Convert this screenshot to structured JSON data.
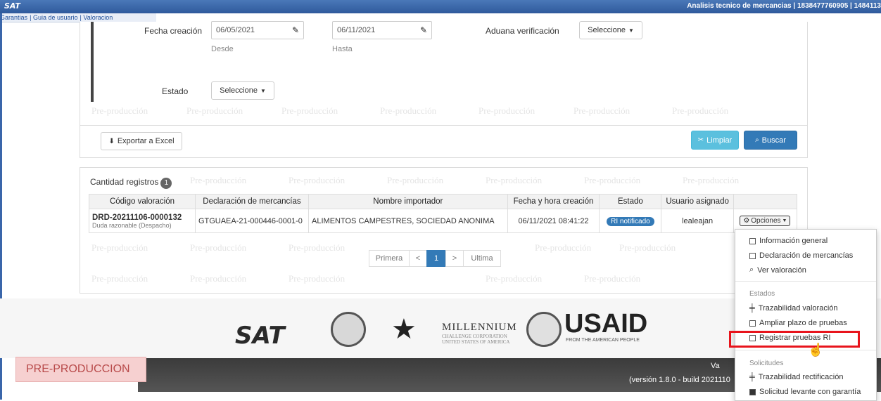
{
  "header": {
    "logo": "SAT",
    "title": "Analisis tecnico de mercancias | 1838477760905 | 1484113",
    "nav": [
      "Garantias",
      "Guia de usuario",
      "Valoracion"
    ]
  },
  "filters": {
    "fecha_label": "Fecha creación",
    "fecha_desde": "06/05/2021",
    "fecha_hasta": "06/11/2021",
    "desde_label": "Desde",
    "hasta_label": "Hasta",
    "aduana_label": "Aduana verificación",
    "aduana_value": "Seleccione",
    "estado_label": "Estado",
    "estado_value": "Seleccione"
  },
  "actions": {
    "export": "Exportar a Excel",
    "clear": "Limpiar",
    "search": "Buscar"
  },
  "results": {
    "count_label": "Cantidad registros",
    "count": "1",
    "columns": [
      "Código valoración",
      "Declaración de mercancías",
      "Nombre importador",
      "Fecha y hora creación",
      "Estado",
      "Usuario asignado",
      ""
    ],
    "row": {
      "codigo": "DRD-20211106-0000132",
      "codigo_sub": "Duda razonable (Despacho)",
      "declaracion": "GTGUAEA-21-000446-0001-0",
      "importador": "ALIMENTOS CAMPESTRES, SOCIEDAD ANONIMA",
      "fecha": "06/11/2021 08:41:22",
      "estado": "RI notificado",
      "usuario": "lealeajan",
      "opciones": "Opciones"
    },
    "pager": [
      "Primera",
      "<",
      "1",
      ">",
      "Ultima"
    ]
  },
  "watermark": "Pre-producción",
  "footer": {
    "logos": [
      "SAT",
      "MILLENNIUM",
      "CHALLENGE CORPORATION",
      "UNITED STATES OF AMERICA",
      "USAID",
      "FROM THE AMERICAN PEOPLE"
    ],
    "env": "PRE-PRODUCCION",
    "version": "(versión 1.8.0 - build 2021110",
    "ver_short": "Va"
  },
  "dropdown": {
    "items1": [
      "Información general",
      "Declaración de mercancías",
      "Ver valoración"
    ],
    "header_estados": "Estados",
    "items2": [
      "Trazabilidad valoración",
      "Ampliar plazo de pruebas",
      "Registrar pruebas RI"
    ],
    "header_solicitudes": "Solicitudes",
    "items3": [
      "Trazabilidad rectificación",
      "Solicitud levante con garantía"
    ]
  }
}
